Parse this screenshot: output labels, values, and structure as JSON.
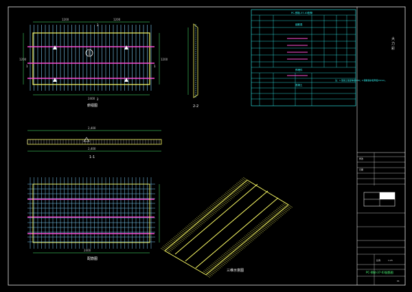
{
  "drawing": {
    "background": "#000000",
    "frame_color": "#e8e8e8",
    "rebar_color": "#7fd3ff",
    "slab_color": "#ffff66",
    "accent_color": "#ff4fd8",
    "dimension_color": "#4fff7a",
    "dimension_text_color": "#cfcfcf",
    "table_color": "#33ffff"
  },
  "views": {
    "plan_label": "俯视图",
    "section_11_label": "1-1",
    "section_22_label": "2-2",
    "iso_label": "三维示意图",
    "plan_dim_top_a": "1200",
    "plan_dim_top_b": "1200",
    "plan_dim_bottom": "2400",
    "plan_dim_left": "1200",
    "plan_dim_right": "1200",
    "section_dim_11": "2,400",
    "section_dim_11b": "2,400",
    "rebar_plan_dim": "2400",
    "rebar_plan_label": "配筋图",
    "plan_section_mark_1": "1",
    "plan_section_mark_2": "2",
    "plan_center_mark": "A"
  },
  "table": {
    "title": "PC-预制-37-03配筋",
    "subtitle_a": "钢筋表",
    "subtitle_b": "预埋件",
    "subtitle_c": "混凝土",
    "note": "注：1.混凝土强度等级C30；2.钢筋保护层厚度15mm。"
  },
  "titleblock": {
    "big_label_1": "大",
    "big_label_2": "力",
    "big_label_3": "彩",
    "drawing_name": "PC-预制-37-03配筋图",
    "revision_label": "修改",
    "date_label": "日期",
    "scale_label": "比例",
    "scale_value": "1:25",
    "page_number": "01"
  }
}
